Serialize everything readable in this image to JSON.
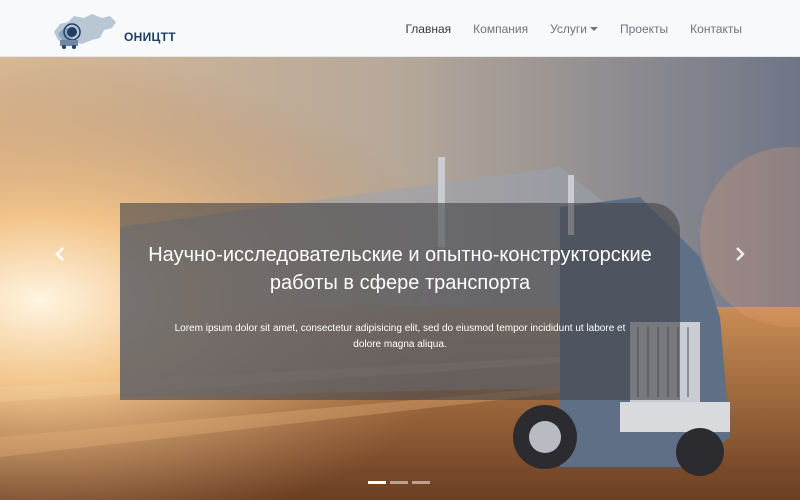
{
  "brand": {
    "logo_text": "ОНИЦТТ"
  },
  "nav": {
    "items": [
      {
        "label": "Главная",
        "active": true
      },
      {
        "label": "Компания",
        "active": false
      },
      {
        "label": "Услуги",
        "active": false,
        "dropdown": true
      },
      {
        "label": "Проекты",
        "active": false
      },
      {
        "label": "Контакты",
        "active": false
      }
    ]
  },
  "hero": {
    "title": "Научно-исследовательские и опытно-конструкторские работы в сфере транспорта",
    "text": "Lorem ipsum dolor sit amet, consectetur adipisicing elit, sed do eiusmod tempor incididunt ut labore et dolore magna aliqua.",
    "prev_icon": "chevron-left-icon",
    "next_icon": "chevron-right-icon",
    "slides": 3,
    "active_slide": 1
  },
  "colors": {
    "navbar_bg": "#f8f9fa",
    "nav_active": "#343a40",
    "nav_inactive": "#6c757d",
    "caption_bg": "rgba(70,70,72,0.62)"
  }
}
